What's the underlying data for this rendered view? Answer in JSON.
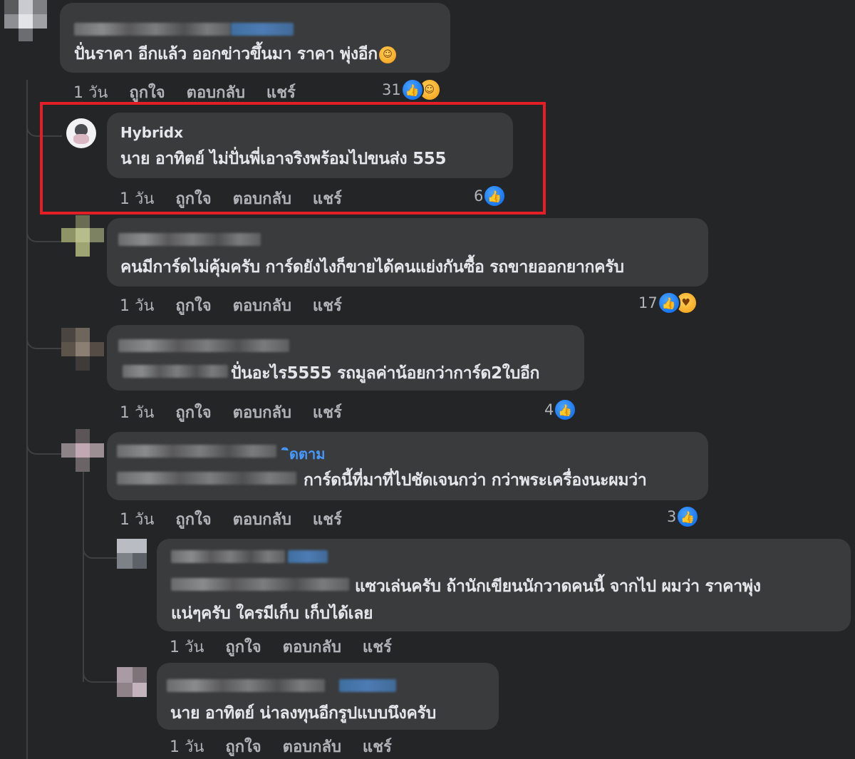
{
  "comments": [
    {
      "text": "ปั่นราคา อีกแล้ว ออกข่าวขึ้นมา ราคา พุ่งอีก",
      "time": "1 วัน",
      "like": "ถูกใจ",
      "reply": "ตอบกลับ",
      "share": "แชร์",
      "reaction_count": "31"
    },
    {
      "name": "Hybridx",
      "text": "นาย อาทิตย์ ไม่ปั่นพี่เอาจริงพร้อมไปขนส่ง 555",
      "time": "1 วัน",
      "like": "ถูกใจ",
      "reply": "ตอบกลับ",
      "share": "แชร์",
      "reaction_count": "6"
    },
    {
      "text": "คนมีการ์ดไม่คุ้มครับ การ์ดยังไงก็ขายได้คนแย่งกันซื้อ รถขายออกยากครับ",
      "time": "1 วัน",
      "like": "ถูกใจ",
      "reply": "ตอบกลับ",
      "share": "แชร์",
      "reaction_count": "17"
    },
    {
      "text": "ปั่นอะไร5555 รถมูลค่าน้อยกว่าการ์ด2ใบอีก",
      "time": "1 วัน",
      "like": "ถูกใจ",
      "reply": "ตอบกลับ",
      "share": "แชร์",
      "reaction_count": "4"
    },
    {
      "follow_fragment": "ิดตาม",
      "text": "การ์ดนี้ที่มาที่ไปชัดเจนกว่า กว่าพระเครื่องนะผมว่า",
      "time": "1 วัน",
      "like": "ถูกใจ",
      "reply": "ตอบกลับ",
      "share": "แชร์",
      "reaction_count": "3"
    },
    {
      "text_line1": "แซวเล่นครับ ถ้านักเขียนนักวาดคนนี้ จากไป ผมว่า ราคาพุ่ง",
      "text_line2": "แน่ๆครับ ใครมีเก็บ เก็บได้เลย",
      "time": "1 วัน",
      "like": "ถูกใจ",
      "reply": "ตอบกลับ",
      "share": "แชร์"
    },
    {
      "text": "นาย อาทิตย์ น่าลงทุนอีกรูปแบบนึงครับ",
      "time": "1 วัน",
      "like": "ถูกใจ",
      "reply": "ตอบกลับ",
      "share": "แชร์"
    }
  ],
  "colors": {
    "background": "#242526",
    "bubble": "#3a3b3c",
    "highlight_border": "#e41e26",
    "like_blue": "#1877f2"
  }
}
